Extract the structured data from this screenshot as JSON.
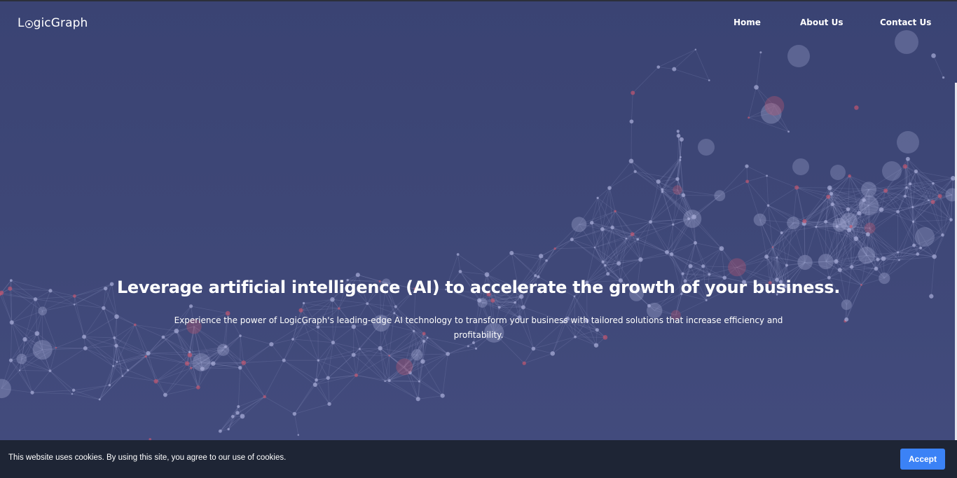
{
  "header": {
    "logo": {
      "prefix": "L",
      "suffix": "gicGraph"
    },
    "nav": [
      {
        "label": "Home"
      },
      {
        "label": "About Us"
      },
      {
        "label": "Contact Us"
      }
    ]
  },
  "hero": {
    "headline": "Leverage artificial intelligence (AI) to accelerate the growth of your business.",
    "subtext": "Experience the power of LogicGraph's leading-edge AI technology to transform your business with tailored solutions that increase efficiency and profitability."
  },
  "cookie_banner": {
    "message": "This website uses cookies. By using this site, you agree to our use of cookies.",
    "accept_label": "Accept"
  },
  "colors": {
    "hero_background": "#3c4574",
    "cookie_bar": "#1e2535",
    "accept_button": "#3b82f6",
    "node_light": "#a9aed8",
    "node_red": "#c0566f"
  }
}
